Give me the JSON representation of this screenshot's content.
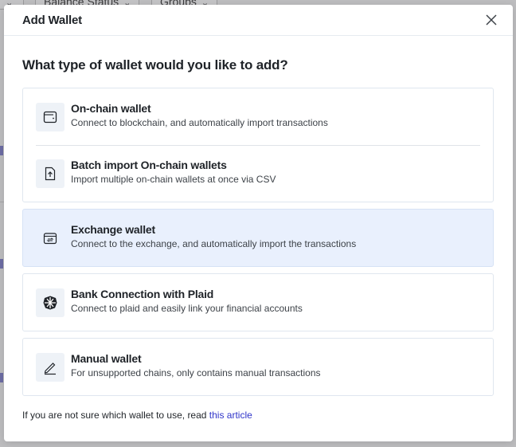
{
  "background": {
    "filters": [
      {
        "label": "Balance Status"
      },
      {
        "label": "Groups"
      }
    ]
  },
  "modal": {
    "title": "Add Wallet",
    "question": "What type of wallet would you like to add?",
    "groups": [
      {
        "options": [
          {
            "title": "On-chain wallet",
            "description": "Connect to blockchain, and automatically import transactions",
            "icon": "wallet-icon"
          },
          {
            "title": "Batch import On-chain wallets",
            "description": "Import multiple on-chain wallets at once via CSV",
            "icon": "file-upload-icon"
          }
        ]
      },
      {
        "selected": true,
        "options": [
          {
            "title": "Exchange wallet",
            "description": "Connect to the exchange, and automatically import the transactions",
            "icon": "exchange-icon"
          }
        ]
      },
      {
        "options": [
          {
            "title": "Bank Connection with Plaid",
            "description": "Connect to plaid and easily link your financial accounts",
            "icon": "plaid-icon"
          }
        ]
      },
      {
        "options": [
          {
            "title": "Manual wallet",
            "description": "For unsupported chains, only contains manual transactions",
            "icon": "pencil-icon"
          }
        ]
      }
    ],
    "footer": {
      "text": "If you are not sure which wallet to use, read ",
      "link": "this article"
    },
    "colors": {
      "accent": "#2f34c9",
      "selected_bg": "#e9f0fd"
    }
  }
}
